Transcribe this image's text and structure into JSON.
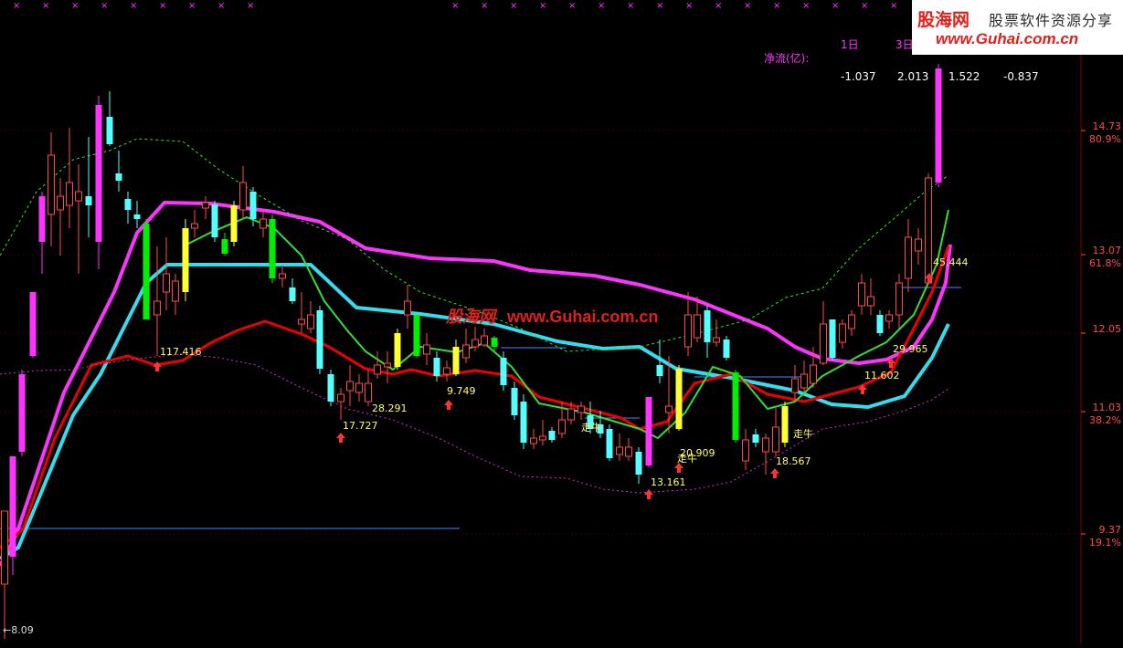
{
  "header": {
    "net_flow_label": "净流(亿):",
    "day1_label": "1日",
    "day3_label": "3日",
    "flow_values": [
      "-1.037",
      "2.013",
      "1.522",
      "-0.837"
    ]
  },
  "logo": {
    "name": "股海网",
    "subtitle": "股票软件资源分享",
    "url": "www.Guhai.com.cn"
  },
  "watermark": {
    "name": "股海网",
    "url": "www.Guhai.com.cn"
  },
  "colors": {
    "up": "#ff4a4a",
    "down": "#54ffff",
    "strong_up": "#ff33ff",
    "strong_down": "#00ee00",
    "yellow": "#ffff33",
    "magenta_line": "#ff33ff",
    "cyan_line": "#33ddee",
    "red_line": "#ee0000",
    "green_line": "#33dd33",
    "axis_text": "#ff4a4a",
    "axis_line": "#7a0000"
  },
  "chart_data": {
    "type": "candlestick",
    "y_axis": {
      "ticks": [
        {
          "price": "14.73",
          "pct": "80.9%"
        },
        {
          "price": "13.07",
          "pct": "61.8%"
        },
        {
          "price": "12.05",
          "pct": ""
        },
        {
          "price": "11.03",
          "pct": "38.2%"
        },
        {
          "price": "9.37",
          "pct": "19.1%"
        }
      ],
      "low_marker": "8.09"
    },
    "annotations": [
      {
        "text": "117.416",
        "cls": "num"
      },
      {
        "text": "17.727",
        "cls": "num"
      },
      {
        "text": "28.291",
        "cls": "num"
      },
      {
        "text": "9.749",
        "cls": "num"
      },
      {
        "text": "13.161",
        "cls": "num"
      },
      {
        "text": "20.909",
        "cls": "num"
      },
      {
        "text": "18.567",
        "cls": "num"
      },
      {
        "text": "11.602",
        "cls": "num"
      },
      {
        "text": "29.965",
        "cls": "num"
      },
      {
        "text": "45.444",
        "cls": "num"
      },
      {
        "text": "走牛",
        "cls": "sig"
      },
      {
        "text": "走牛",
        "cls": "sig"
      },
      {
        "text": "走牛",
        "cls": "sig"
      }
    ]
  }
}
